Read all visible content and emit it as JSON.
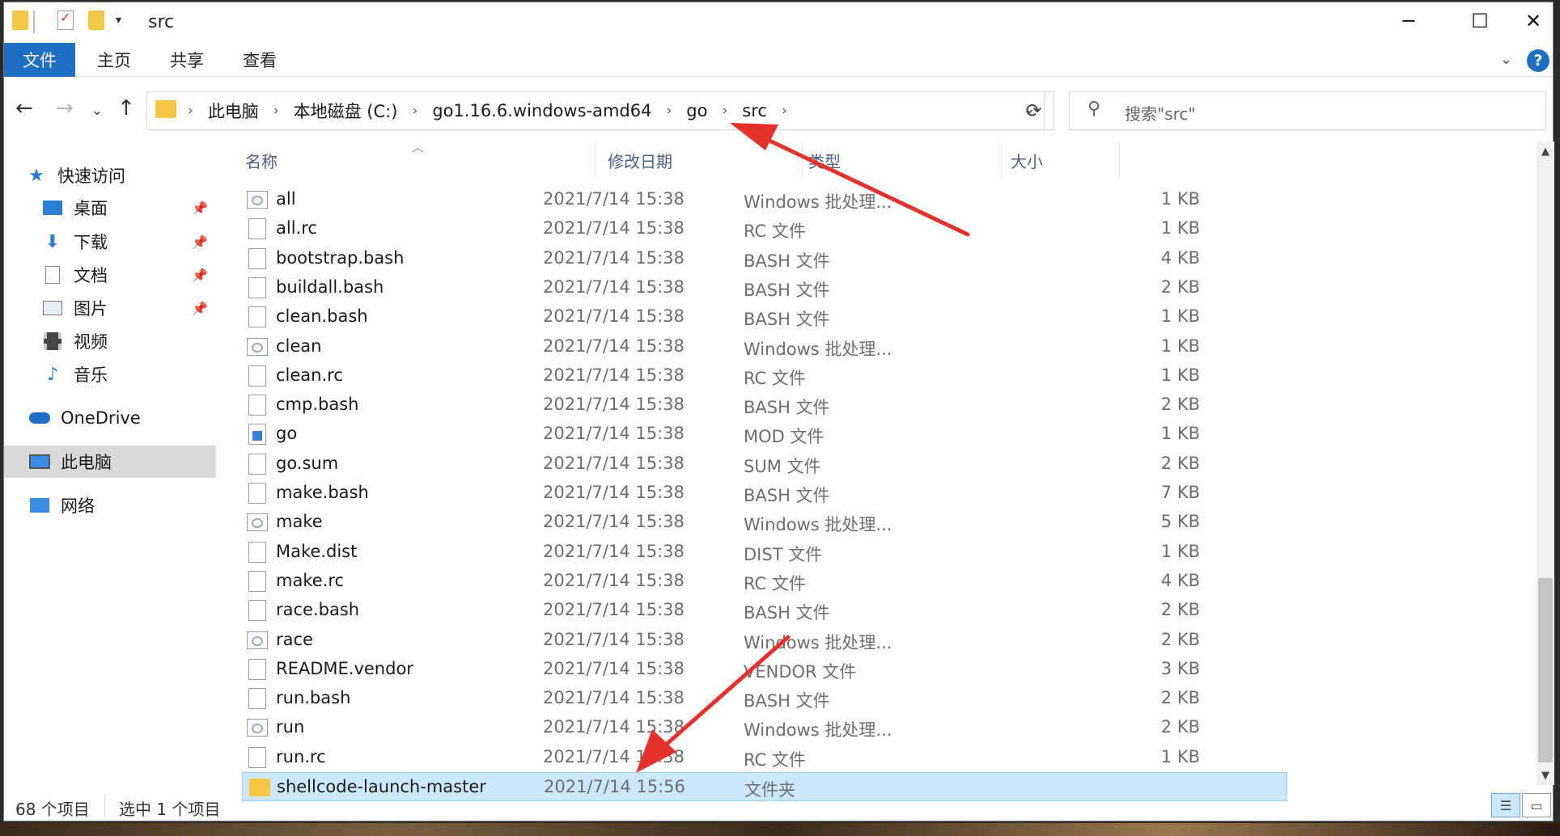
{
  "window": {
    "title": "src",
    "controls": {
      "minimize": "─",
      "maximize": "☐",
      "close": "✕"
    }
  },
  "ribbon": {
    "tabs": [
      "文件",
      "主页",
      "共享",
      "查看"
    ],
    "help": "?"
  },
  "address": {
    "breadcrumbs": [
      "此电脑",
      "本地磁盘 (C:)",
      "go1.16.6.windows-amd64",
      "go",
      "src"
    ],
    "search_placeholder": "搜索\"src\""
  },
  "nav": {
    "quick_access": "快速访问",
    "items": [
      {
        "label": "桌面",
        "icon": "desktop-icon",
        "pinned": true
      },
      {
        "label": "下载",
        "icon": "download-icon",
        "pinned": true
      },
      {
        "label": "文档",
        "icon": "document-icon",
        "pinned": true
      },
      {
        "label": "图片",
        "icon": "picture-icon",
        "pinned": true
      },
      {
        "label": "视频",
        "icon": "video-icon",
        "pinned": false
      },
      {
        "label": "音乐",
        "icon": "music-icon",
        "pinned": false
      }
    ],
    "onedrive": "OneDrive",
    "this_pc": "此电脑",
    "network": "网络"
  },
  "columns": {
    "name": "名称",
    "date": "修改日期",
    "type": "类型",
    "size": "大小"
  },
  "files": [
    {
      "name": "all",
      "date": "2021/7/14 15:38",
      "type": "Windows 批处理...",
      "size": "1 KB",
      "icon": "bat"
    },
    {
      "name": "all.rc",
      "date": "2021/7/14 15:38",
      "type": "RC 文件",
      "size": "1 KB",
      "icon": "file"
    },
    {
      "name": "bootstrap.bash",
      "date": "2021/7/14 15:38",
      "type": "BASH 文件",
      "size": "4 KB",
      "icon": "file"
    },
    {
      "name": "buildall.bash",
      "date": "2021/7/14 15:38",
      "type": "BASH 文件",
      "size": "2 KB",
      "icon": "file"
    },
    {
      "name": "clean.bash",
      "date": "2021/7/14 15:38",
      "type": "BASH 文件",
      "size": "1 KB",
      "icon": "file"
    },
    {
      "name": "clean",
      "date": "2021/7/14 15:38",
      "type": "Windows 批处理...",
      "size": "1 KB",
      "icon": "bat"
    },
    {
      "name": "clean.rc",
      "date": "2021/7/14 15:38",
      "type": "RC 文件",
      "size": "1 KB",
      "icon": "file"
    },
    {
      "name": "cmp.bash",
      "date": "2021/7/14 15:38",
      "type": "BASH 文件",
      "size": "2 KB",
      "icon": "file"
    },
    {
      "name": "go",
      "date": "2021/7/14 15:38",
      "type": "MOD 文件",
      "size": "1 KB",
      "icon": "mod"
    },
    {
      "name": "go.sum",
      "date": "2021/7/14 15:38",
      "type": "SUM 文件",
      "size": "2 KB",
      "icon": "file"
    },
    {
      "name": "make.bash",
      "date": "2021/7/14 15:38",
      "type": "BASH 文件",
      "size": "7 KB",
      "icon": "file"
    },
    {
      "name": "make",
      "date": "2021/7/14 15:38",
      "type": "Windows 批处理...",
      "size": "5 KB",
      "icon": "bat"
    },
    {
      "name": "Make.dist",
      "date": "2021/7/14 15:38",
      "type": "DIST 文件",
      "size": "1 KB",
      "icon": "file"
    },
    {
      "name": "make.rc",
      "date": "2021/7/14 15:38",
      "type": "RC 文件",
      "size": "4 KB",
      "icon": "file"
    },
    {
      "name": "race.bash",
      "date": "2021/7/14 15:38",
      "type": "BASH 文件",
      "size": "2 KB",
      "icon": "file"
    },
    {
      "name": "race",
      "date": "2021/7/14 15:38",
      "type": "Windows 批处理...",
      "size": "2 KB",
      "icon": "bat"
    },
    {
      "name": "README.vendor",
      "date": "2021/7/14 15:38",
      "type": "VENDOR 文件",
      "size": "3 KB",
      "icon": "file"
    },
    {
      "name": "run.bash",
      "date": "2021/7/14 15:38",
      "type": "BASH 文件",
      "size": "2 KB",
      "icon": "file"
    },
    {
      "name": "run",
      "date": "2021/7/14 15:38",
      "type": "Windows 批处理...",
      "size": "2 KB",
      "icon": "bat"
    },
    {
      "name": "run.rc",
      "date": "2021/7/14 15:38",
      "type": "RC 文件",
      "size": "1 KB",
      "icon": "file"
    },
    {
      "name": "shellcode-launch-master",
      "date": "2021/7/14 15:56",
      "type": "文件夹",
      "size": "",
      "icon": "folder",
      "selected": true
    }
  ],
  "status": {
    "item_count": "68 个项目",
    "selected_count": "选中 1 个项目"
  },
  "colors": {
    "accent": "#1e6fc3",
    "selection": "#cce8ff",
    "annotation_arrow": "#e5312b",
    "folder": "#f4c845"
  }
}
